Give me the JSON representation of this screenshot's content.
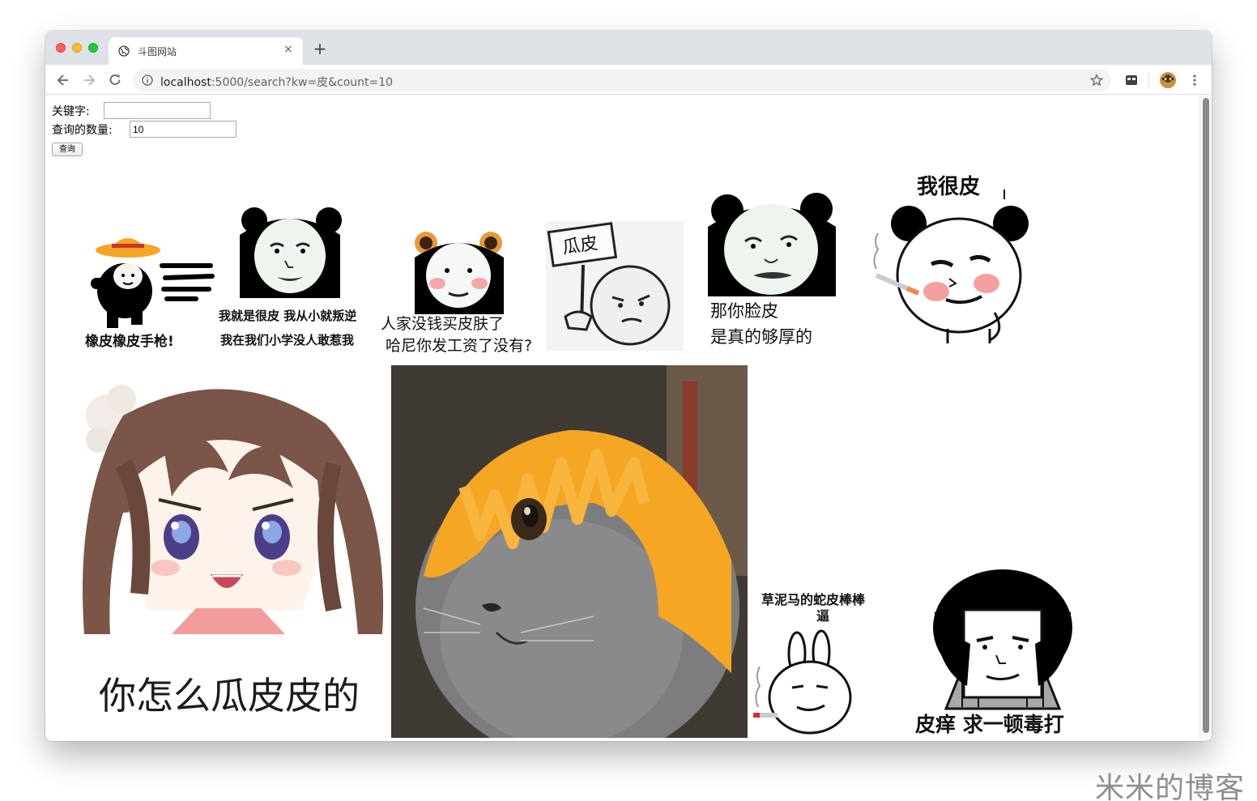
{
  "tab": {
    "title": "斗图网站",
    "close": "×",
    "new_tab": "+"
  },
  "address_bar": {
    "host": "localhost",
    "rest": ":5000/search?kw=皮&count=10"
  },
  "form": {
    "keyword_label": "关键字:",
    "keyword_value": "",
    "count_label": "查询的数量:",
    "count_value": "10",
    "submit_label": "查询"
  },
  "memes": [
    {
      "id": "m1",
      "caption": "橡皮橡皮手枪!"
    },
    {
      "id": "m2",
      "caption_line1": "我就是很皮  我从小就叛逆",
      "caption_line2": "我在我们小学没人敢惹我"
    },
    {
      "id": "m3",
      "caption_line1": "人家没钱买皮肤了",
      "caption_line2": "哈尼你发工资了没有?"
    },
    {
      "id": "m4",
      "sign": "瓜皮"
    },
    {
      "id": "m5",
      "caption_line1": "那你脸皮",
      "caption_line2": "是真的够厚的"
    },
    {
      "id": "m6",
      "caption": "我很皮"
    },
    {
      "id": "m7",
      "caption": "你怎么瓜皮皮的"
    },
    {
      "id": "m8",
      "caption": ""
    },
    {
      "id": "m9",
      "caption_line1": "草泥马的蛇皮棒棒",
      "caption_line2": "逼"
    },
    {
      "id": "m10",
      "caption": "皮痒  求一顿毒打"
    }
  ],
  "watermark": "米米的博客",
  "colors": {
    "tabbar": "#dee1e6",
    "omnibox": "#f1f3f4",
    "close_red": "#fe5f57",
    "minimize_yellow": "#febc2e",
    "zoom_green": "#28c840",
    "cat_hat": "#f5a623"
  }
}
